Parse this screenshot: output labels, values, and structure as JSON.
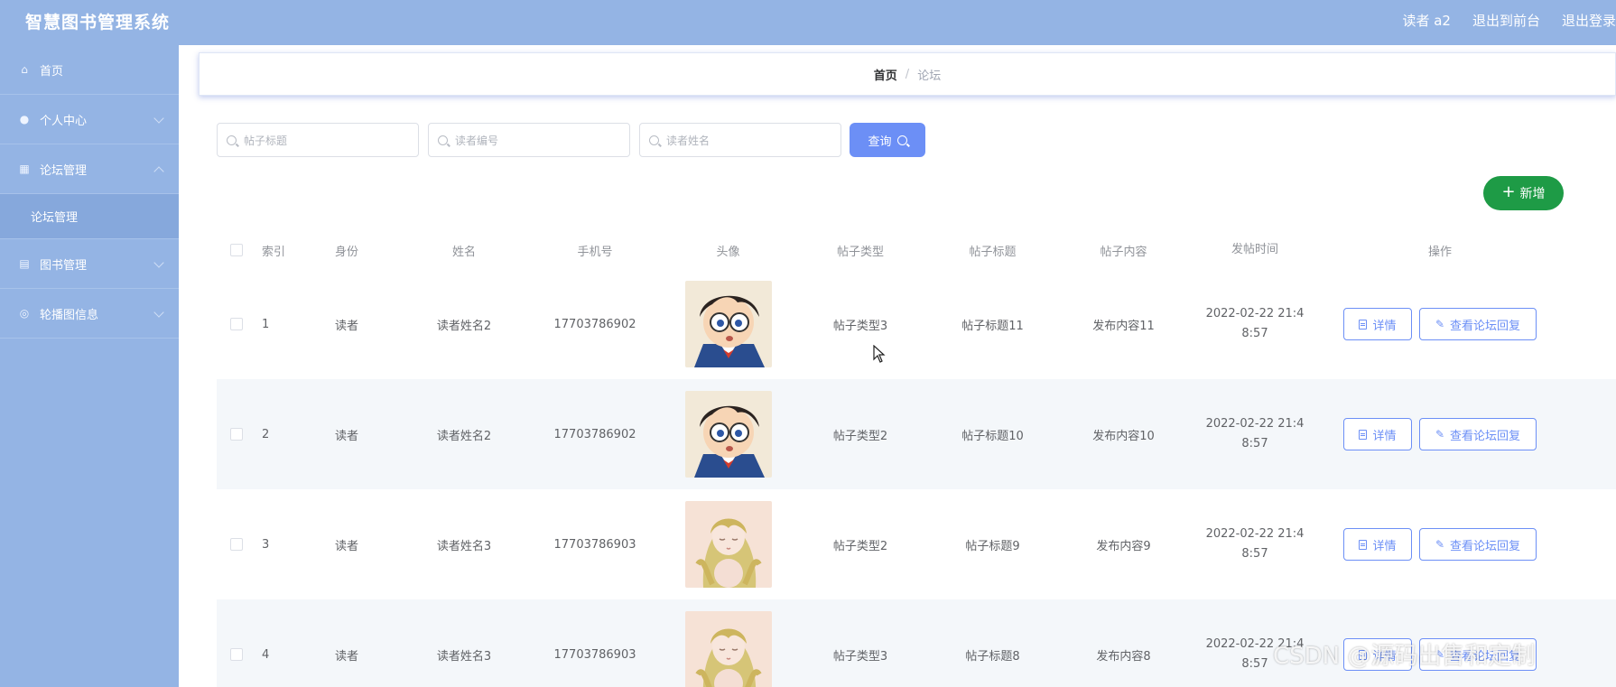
{
  "header": {
    "app_title": "智慧图书管理系统",
    "user_label": "读者 a2",
    "back_front_label": "退出到前台",
    "logout_label": "退出登录"
  },
  "sidebar": {
    "items": [
      {
        "label": "首页",
        "icon": "home-icon"
      },
      {
        "label": "个人中心",
        "icon": "user-icon"
      },
      {
        "label": "论坛管理",
        "icon": "forum-icon"
      },
      {
        "label": "论坛管理",
        "icon": "",
        "sub": true
      },
      {
        "label": "图书管理",
        "icon": "book-icon"
      },
      {
        "label": "轮播图信息",
        "icon": "carousel-icon"
      }
    ]
  },
  "breadcrumb": {
    "home": "首页",
    "separator": "/",
    "current": "论坛"
  },
  "search": {
    "title_placeholder": "帖子标题",
    "reader_id_placeholder": "读者编号",
    "reader_name_placeholder": "读者姓名",
    "query_label": "查询"
  },
  "actions": {
    "add_label": "新增"
  },
  "table": {
    "headers": [
      "索引",
      "身份",
      "姓名",
      "手机号",
      "头像",
      "帖子类型",
      "帖子标题",
      "帖子内容",
      "发帖时间",
      "操作"
    ],
    "rows": [
      {
        "index": "1",
        "role": "读者",
        "name": "读者姓名2",
        "phone": "17703786902",
        "avatar": "boy-avatar",
        "type": "帖子类型3",
        "title": "帖子标题11",
        "content": "发布内容11",
        "time": "2022-02-22 21:48:57"
      },
      {
        "index": "2",
        "role": "读者",
        "name": "读者姓名2",
        "phone": "17703786902",
        "avatar": "boy-avatar",
        "type": "帖子类型2",
        "title": "帖子标题10",
        "content": "发布内容10",
        "time": "2022-02-22 21:48:57"
      },
      {
        "index": "3",
        "role": "读者",
        "name": "读者姓名3",
        "phone": "17703786903",
        "avatar": "girl-avatar",
        "type": "帖子类型2",
        "title": "帖子标题9",
        "content": "发布内容9",
        "time": "2022-02-22 21:48:57"
      },
      {
        "index": "4",
        "role": "读者",
        "name": "读者姓名3",
        "phone": "17703786903",
        "avatar": "girl-avatar",
        "type": "帖子类型3",
        "title": "帖子标题8",
        "content": "发布内容8",
        "time": "2022-02-22 21:48:57"
      }
    ],
    "detail_label": "详情",
    "reply_label": "查看论坛回复"
  },
  "watermark": "CSDN @源码出售和定制",
  "colors": {
    "sidebar_bg": "#94b4e4",
    "primary": "#6c8ff6",
    "success": "#1e9b46"
  }
}
